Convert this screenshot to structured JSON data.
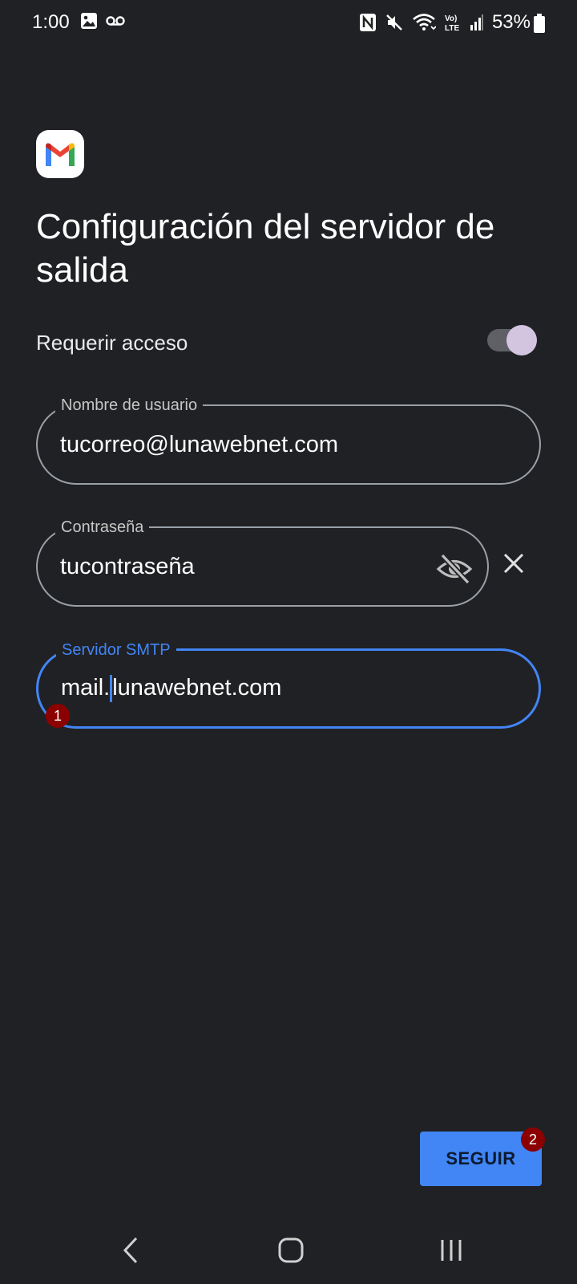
{
  "status_bar": {
    "time": "1:00",
    "battery": "53%",
    "icons": [
      "image-icon",
      "voicemail-icon",
      "nfc-icon",
      "mute-icon",
      "wifi-icon",
      "volte-icon",
      "signal-icon",
      "battery-icon"
    ]
  },
  "app": {
    "logo": "gmail-icon"
  },
  "page": {
    "title": "Configuración del servidor de salida"
  },
  "require_access": {
    "label": "Requerir acceso",
    "enabled": true
  },
  "fields": {
    "username": {
      "label": "Nombre de usuario",
      "value": "tucorreo@lunawebnet.com"
    },
    "password": {
      "label": "Contraseña",
      "value": "tucontraseña"
    },
    "smtp": {
      "label": "Servidor SMTP",
      "value_before_cursor": "mail.",
      "value_after_cursor": "lunawebnet.com"
    }
  },
  "annotations": {
    "badge1": "1",
    "badge2": "2"
  },
  "actions": {
    "next_label": "SEGUIR"
  },
  "colors": {
    "background": "#202124",
    "accent": "#4285f4",
    "badge": "#8b0000"
  }
}
